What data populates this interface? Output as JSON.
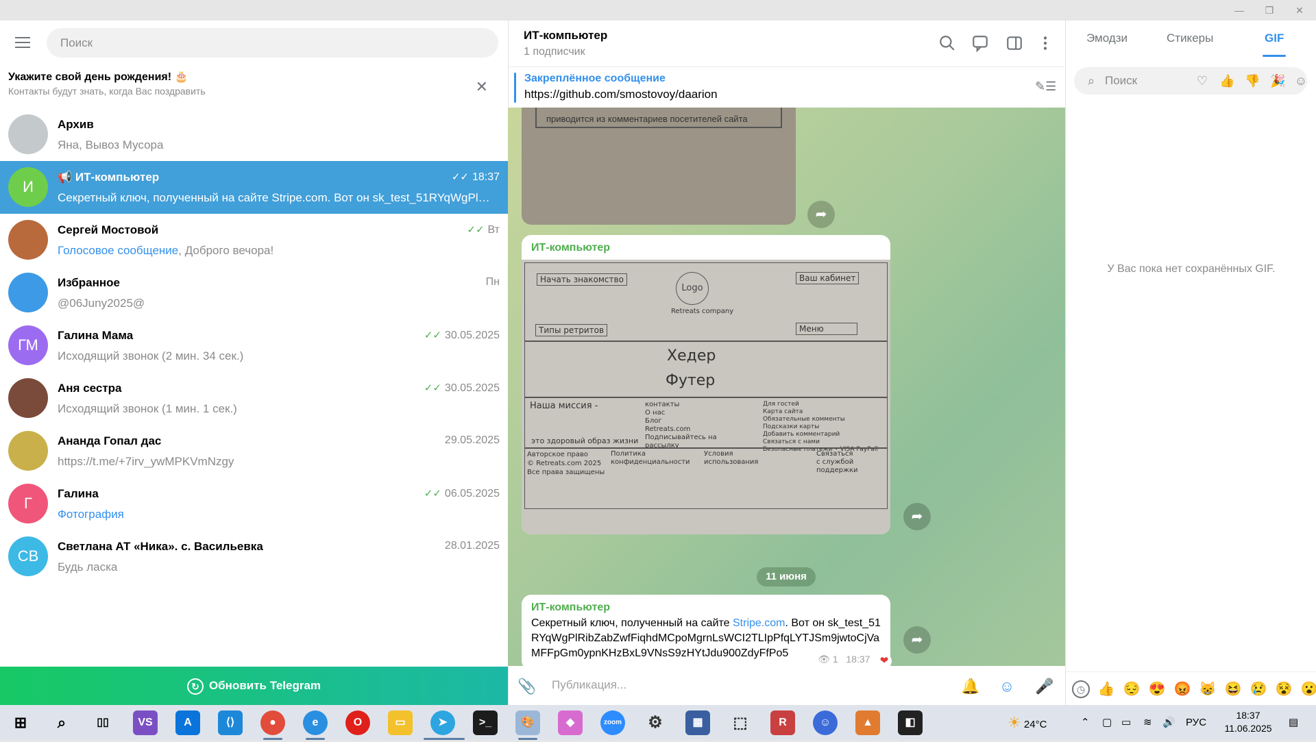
{
  "search": {
    "placeholder": "Поиск"
  },
  "birthday": {
    "title": "Укажите свой день рождения! 🎂",
    "subtitle": "Контакты будут знать, когда Вас поздравить"
  },
  "chats": [
    {
      "name": "Архив",
      "preview": "Яна, Вывоз Мусора",
      "time": "",
      "avatar": "",
      "avatar_color": "#c4c9cc",
      "check": ""
    },
    {
      "name": "📢 ИТ-компьютер",
      "preview": "Секретный ключ, полученный на сайте Stripe.com. Вот он sk_test_51RYqWgPlRibZ…",
      "time": "18:37",
      "avatar": "И",
      "avatar_color": "#6fcd4c",
      "check": "✓✓"
    },
    {
      "name": "Сергей Мостовой",
      "preview_blue": "Голосовое сообщение",
      "preview": ", Доброго вечора!",
      "time": "Вт",
      "avatar": "",
      "avatar_color": "#b96a3c",
      "check": "✓✓"
    },
    {
      "name": "Избранное",
      "preview": "@06Juny2025@",
      "time": "Пн",
      "avatar": "",
      "avatar_color": "#3d9ae6",
      "check": ""
    },
    {
      "name": "Галина Мама",
      "preview": "Исходящий звонок (2 мин. 34 сек.)",
      "time": "30.05.2025",
      "avatar": "ГМ",
      "avatar_color": "#9c6cf0",
      "check": "✓✓"
    },
    {
      "name": "Аня сестра",
      "preview": "Исходящий звонок (1 мин. 1 сек.)",
      "time": "30.05.2025",
      "avatar": "",
      "avatar_color": "#7a4a3a",
      "check": "✓✓"
    },
    {
      "name": "Ананда Гопал дас",
      "preview": "https://t.me/+7irv_ywMPKVmNzgy",
      "time": "29.05.2025",
      "avatar": "",
      "avatar_color": "#c9b04a",
      "check": ""
    },
    {
      "name": "Галина",
      "preview_blue": "Фотография",
      "preview": "",
      "time": "06.05.2025",
      "avatar": "Г",
      "avatar_color": "#f0567a",
      "check": "✓✓"
    },
    {
      "name": "Светлана АТ «Ника». с. Васильевка",
      "preview": "Будь ласка",
      "time": "28.01.2025",
      "avatar": "СВ",
      "avatar_color": "#3db9e6",
      "check": ""
    }
  ],
  "update_label": "Обновить Telegram",
  "header": {
    "title": "ИТ-компьютер",
    "subtitle": "1 подписчик"
  },
  "pinned": {
    "title": "Закреплённое сообщение",
    "url": "https://github.com/smostovoy/daarion"
  },
  "photo1_caption": "приводится из комментариев посетителей сайта",
  "sketch": {
    "start": "Начать знакомство",
    "cabinet": "Ваш кабинет",
    "types": "Типы ретритов",
    "menu": "Меню",
    "logo": "Logo",
    "brand": "Retreats company",
    "header": "Хедер",
    "footer": "Футер",
    "mission": "Наша миссия -",
    "lifestyle": "это здоровый образ жизни",
    "contacts": "контакты\nО нас\nБлог\nRetreats.com\nПодписывайтесь на\nрассылку",
    "guests": "Для гостей\nКарта сайта\nОбязательные комменты\nПодсказки карты\nДобавить комментарий\nСвязаться с нами\nБезопасные платежи • VISA PayPall",
    "copyright": "Авторское право\n© Retreats.com 2025\nВсе права защищены",
    "privacy": "Политика\nконфиденциальности",
    "terms": "Условия\nиспользования",
    "support": "Связаться\nс службой\nподдержки"
  },
  "bubble_author": "ИТ-компьютер",
  "date_pill": "11 июня",
  "message": {
    "author": "ИТ-компьютер",
    "text_pre": "Секретный ключ, полученный на сайте ",
    "link": "Stripe.com",
    "text_post": ". Вот он sk_test_51RYqWgPlRibZabZwfFiqhdMCpoMgrnLsWCI2TLIpPfqLYTJSm9jwtoCjVaMFFpGm0ypnKHzBxL9VNsS9zHYtJdu900ZdyFfPo5",
    "views": "1",
    "time": "18:37"
  },
  "compose": {
    "placeholder": "Публикация..."
  },
  "right": {
    "tabs": [
      "Эмодзи",
      "Стикеры",
      "GIF"
    ],
    "search_placeholder": "Поиск",
    "empty": "У Вас пока нет сохранённых GIF."
  },
  "taskbar": {
    "weather": "24°C",
    "lang": "РУС",
    "time": "18:37",
    "date": "11.06.2025"
  }
}
